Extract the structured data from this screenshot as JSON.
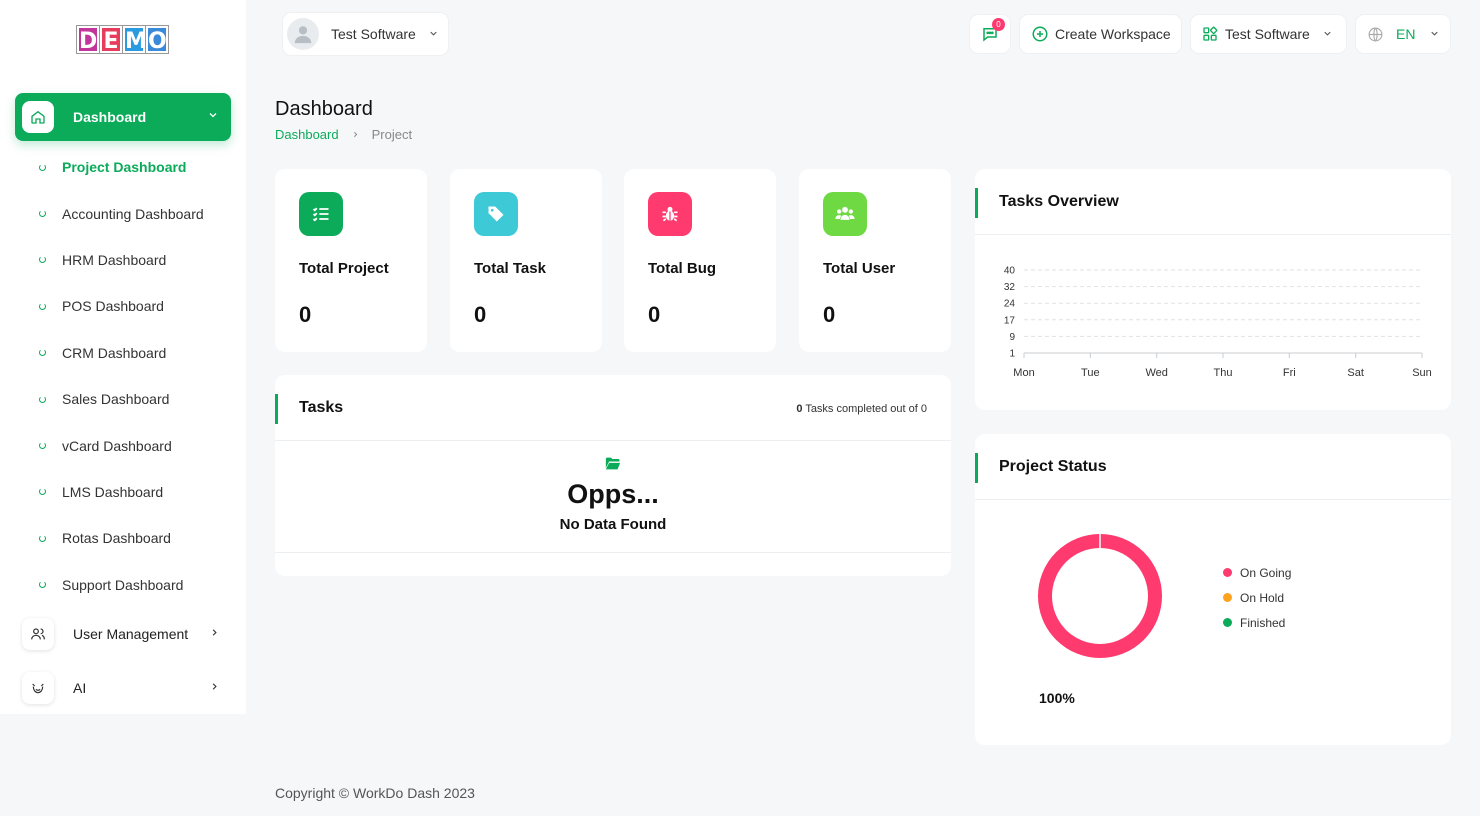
{
  "logo": {
    "letters": [
      "D",
      "E",
      "M",
      "O"
    ],
    "colors": [
      "#c2369b",
      "#e53d5b",
      "#2b9be0",
      "#3a8ad9"
    ]
  },
  "header": {
    "user_name": "Test Software",
    "notifications_count": "0",
    "create_workspace": "Create Workspace",
    "workspace_name": "Test Software",
    "language": "EN"
  },
  "sidebar": {
    "dashboard_label": "Dashboard",
    "items": [
      "Project Dashboard",
      "Accounting Dashboard",
      "HRM Dashboard",
      "POS Dashboard",
      "CRM Dashboard",
      "Sales Dashboard",
      "vCard Dashboard",
      "LMS Dashboard",
      "Rotas Dashboard",
      "Support Dashboard"
    ],
    "user_management": "User Management",
    "ai": "AI"
  },
  "page": {
    "title": "Dashboard",
    "breadcrumb": [
      "Dashboard",
      "Project"
    ]
  },
  "stats": [
    {
      "title": "Total Project",
      "value": "0",
      "color": "#0cab5a",
      "icon": "list-check-icon"
    },
    {
      "title": "Total Task",
      "value": "0",
      "color": "#3ec9d6",
      "icon": "tag-icon"
    },
    {
      "title": "Total Bug",
      "value": "0",
      "color": "#ff3a6e",
      "icon": "bug-icon"
    },
    {
      "title": "Total User",
      "value": "0",
      "color": "#6fd943",
      "icon": "users-icon"
    }
  ],
  "tasks": {
    "title": "Tasks",
    "completed_count": "0",
    "completed_text": "Tasks completed out of 0",
    "empty_title": "Opps...",
    "empty_subtitle": "No Data Found"
  },
  "overview": {
    "title": "Tasks Overview"
  },
  "project_status": {
    "title": "Project Status",
    "legend": [
      {
        "name": "On Going",
        "color": "#ff3a6e"
      },
      {
        "name": "On Hold",
        "color": "#ffa21d"
      },
      {
        "name": "Finished",
        "color": "#0cab5a"
      }
    ],
    "percent": "100%"
  },
  "chart_data": [
    {
      "type": "line",
      "title": "",
      "categories": [
        "Mon",
        "Tue",
        "Wed",
        "Thu",
        "Fri",
        "Sat",
        "Sun"
      ],
      "y_ticks": [
        "40",
        "32",
        "24",
        "17",
        "9",
        "1"
      ],
      "ylim": [
        1,
        40
      ],
      "series": [],
      "grid": true
    },
    {
      "type": "pie",
      "title": "",
      "labels": [
        "On Going",
        "On Hold",
        "Finished"
      ],
      "values": [
        100,
        0,
        0
      ],
      "colors": [
        "#ff3a6e",
        "#ffa21d",
        "#0cab5a"
      ],
      "legend": "right"
    }
  ],
  "footer": {
    "copyright": "Copyright © WorkDo Dash 2023"
  }
}
